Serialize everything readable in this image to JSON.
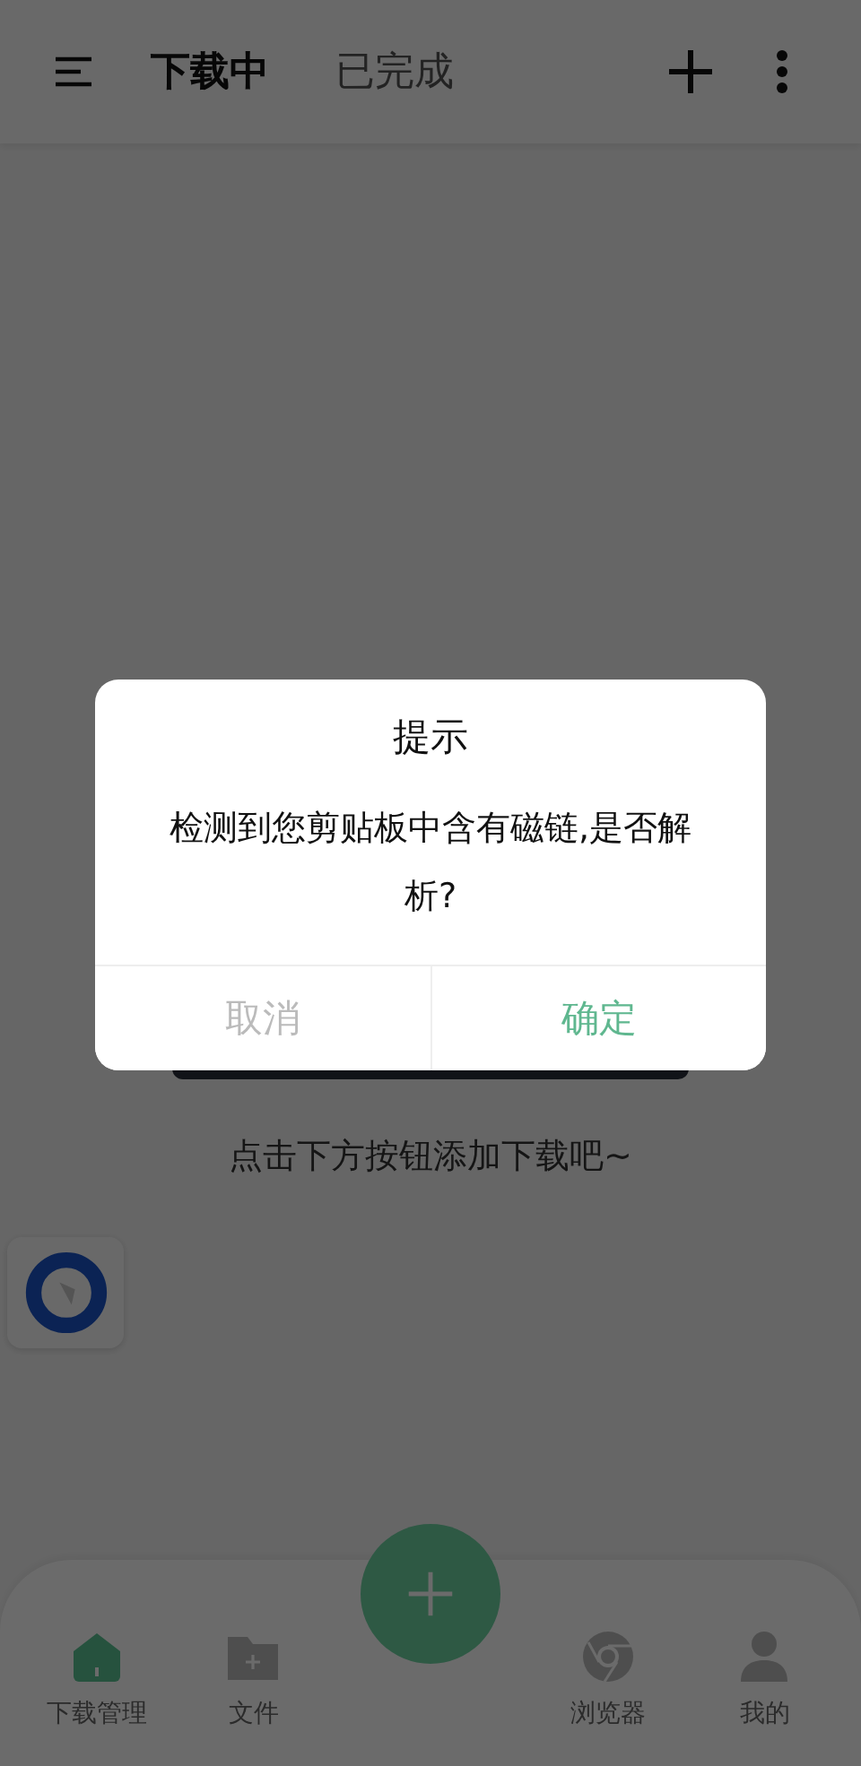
{
  "header": {
    "tabs": [
      {
        "label": "下载中",
        "selected": true
      },
      {
        "label": "已完成",
        "selected": false
      }
    ]
  },
  "empty_hint": "点击下方按钮添加下载吧~",
  "bottom_nav": {
    "items": [
      {
        "label": "下载管理",
        "kind": "home",
        "selected": true
      },
      {
        "label": "文件",
        "kind": "folder",
        "selected": false
      },
      {
        "label": "浏览器",
        "kind": "browser",
        "selected": false
      },
      {
        "label": "我的",
        "kind": "profile",
        "selected": false
      }
    ]
  },
  "dialog": {
    "title": "提示",
    "message": "检测到您剪贴板中含有磁链,是否解析?",
    "buttons": [
      {
        "label": "取消",
        "kind": "cancel"
      },
      {
        "label": "确定",
        "kind": "confirm"
      }
    ]
  }
}
